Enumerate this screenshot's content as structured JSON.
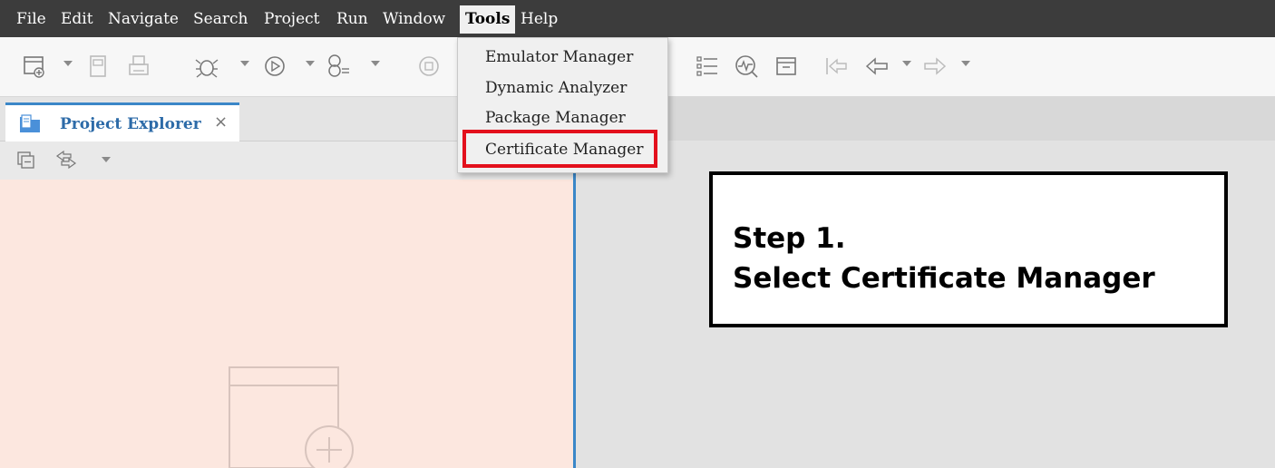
{
  "menubar": {
    "items": [
      "File",
      "Edit",
      "Navigate",
      "Search",
      "Project",
      "Run",
      "Window",
      "Tools",
      "Help"
    ],
    "active": "Tools"
  },
  "tools_menu": {
    "items": [
      "Emulator Manager",
      "Dynamic Analyzer",
      "Package Manager",
      "Certificate Manager"
    ],
    "highlighted": "Certificate Manager"
  },
  "project_explorer": {
    "tab_label": "Project Explorer",
    "close_glyph": "×"
  },
  "callout": {
    "line1": "Step 1.",
    "line2": "Select Certificate Manager"
  },
  "colors": {
    "menubar_bg": "#3c3c3c",
    "highlight_border": "#e3101c",
    "tab_accent": "#3b87c8",
    "explorer_bg": "#fce7df"
  }
}
